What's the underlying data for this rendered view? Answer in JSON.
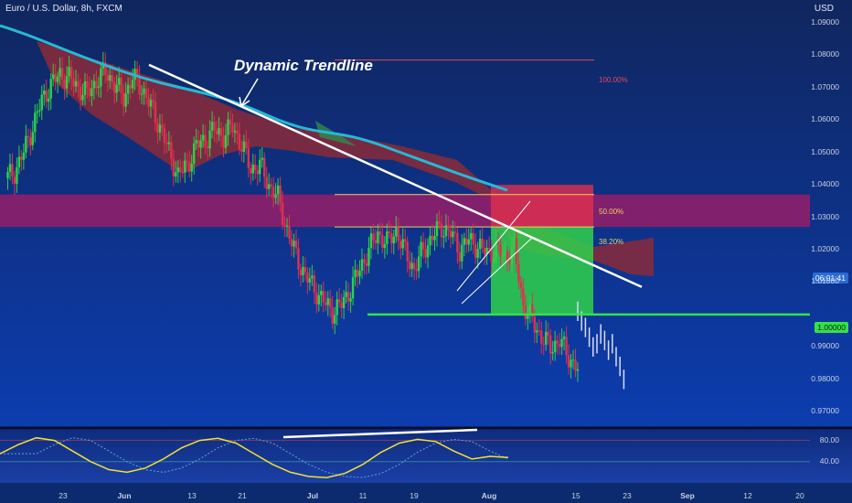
{
  "header": {
    "title": "Euro / U.S. Dollar, 8h, FXCM",
    "currency": "USD"
  },
  "annotation": "Dynamic Trendline",
  "fib_labels": [
    "100.00%",
    "50.00%",
    "38.20%"
  ],
  "price_tag": "1.00000",
  "countdown_tag": "06:01:41",
  "colors": {
    "bg_top": "#10265e",
    "bg_bottom": "#0c3db0",
    "cloud": "#8a2a3a",
    "ma": "#25b9d6",
    "support": "#35e04a",
    "zone": "#8e1f6a",
    "oscillator": "#f5e230"
  },
  "chart_data": [
    {
      "type": "candlestick",
      "ylim": [
        0.965,
        1.097
      ],
      "y_ticks": [
        "1.09000",
        "1.08000",
        "1.07000",
        "1.06000",
        "1.05000",
        "1.04000",
        "1.03000",
        "1.02000",
        "1.01000",
        "0.99000",
        "0.98000",
        "0.97000"
      ],
      "y_tick_values": [
        1.09,
        1.08,
        1.07,
        1.06,
        1.05,
        1.04,
        1.03,
        1.02,
        1.01,
        0.99,
        0.98,
        0.97
      ],
      "x_ticks": [
        "23",
        "Jun",
        "13",
        "21",
        "Jul",
        "11",
        "19",
        "Aug",
        "15",
        "23",
        "Sep",
        "12",
        "20"
      ],
      "support_level": 1.0,
      "resistance_zone": [
        1.027,
        1.037
      ],
      "trendline": [
        [
          1.077,
          1.0085
        ]
      ],
      "fib_levels": [
        {
          "label": "100.00%",
          "value": 1.0785
        },
        {
          "label": "50.00%",
          "value": 1.037
        },
        {
          "label": "38.20%",
          "value": 1.027
        }
      ],
      "close_path": [
        1.042,
        1.044,
        1.05,
        1.058,
        1.066,
        1.071,
        1.074,
        1.073,
        1.07,
        1.068,
        1.072,
        1.075,
        1.071,
        1.067,
        1.073,
        1.07,
        1.064,
        1.058,
        1.05,
        1.043,
        1.046,
        1.052,
        1.054,
        1.057,
        1.055,
        1.058,
        1.052,
        1.045,
        1.046,
        1.04,
        1.036,
        1.026,
        1.018,
        1.012,
        1.008,
        1.004,
        1.001,
        1.003,
        1.008,
        1.014,
        1.02,
        1.025,
        1.022,
        1.026,
        1.019,
        1.014,
        1.02,
        1.024,
        1.027,
        1.025,
        1.02,
        1.023,
        1.021,
        1.019,
        1.02,
        1.018,
        1.02,
        1.003,
        0.998,
        0.993,
        0.99,
        0.992,
        0.987,
        0.983
      ]
    },
    {
      "type": "line",
      "name": "",
      "ylim": [
        0,
        100
      ],
      "y_ticks": [
        "80.00",
        "40.00"
      ],
      "y_tick_values": [
        80,
        40
      ],
      "values": [
        55,
        72,
        85,
        80,
        60,
        40,
        25,
        20,
        28,
        45,
        66,
        80,
        84,
        75,
        55,
        35,
        20,
        12,
        10,
        18,
        35,
        58,
        75,
        82,
        78,
        60,
        45,
        50,
        48
      ]
    }
  ]
}
